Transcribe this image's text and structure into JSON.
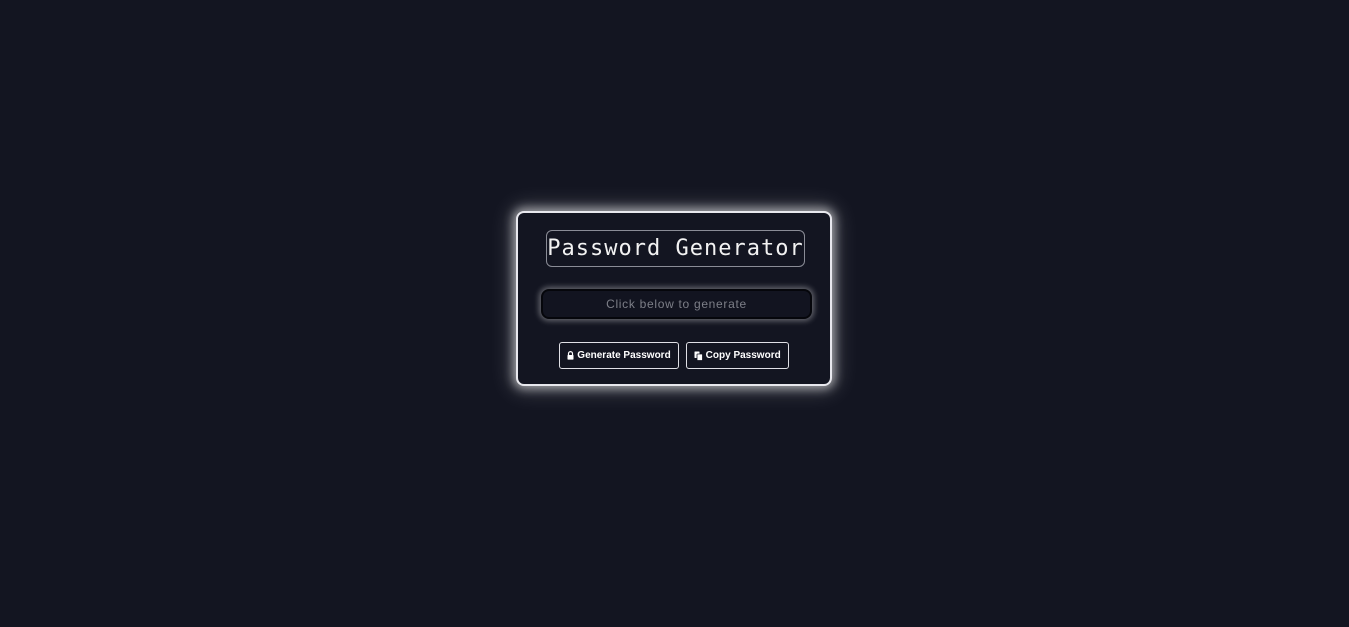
{
  "app": {
    "title": "Password Generator"
  },
  "output": {
    "value": "",
    "placeholder": "Click below to generate"
  },
  "buttons": {
    "generate": {
      "label": "Generate Password",
      "icon": "lock-icon"
    },
    "copy": {
      "label": "Copy Password",
      "icon": "copy-icon"
    }
  },
  "colors": {
    "background": "#131521",
    "border": "#e8e8ee",
    "text": "#ffffff",
    "placeholder": "#7d7f88"
  }
}
